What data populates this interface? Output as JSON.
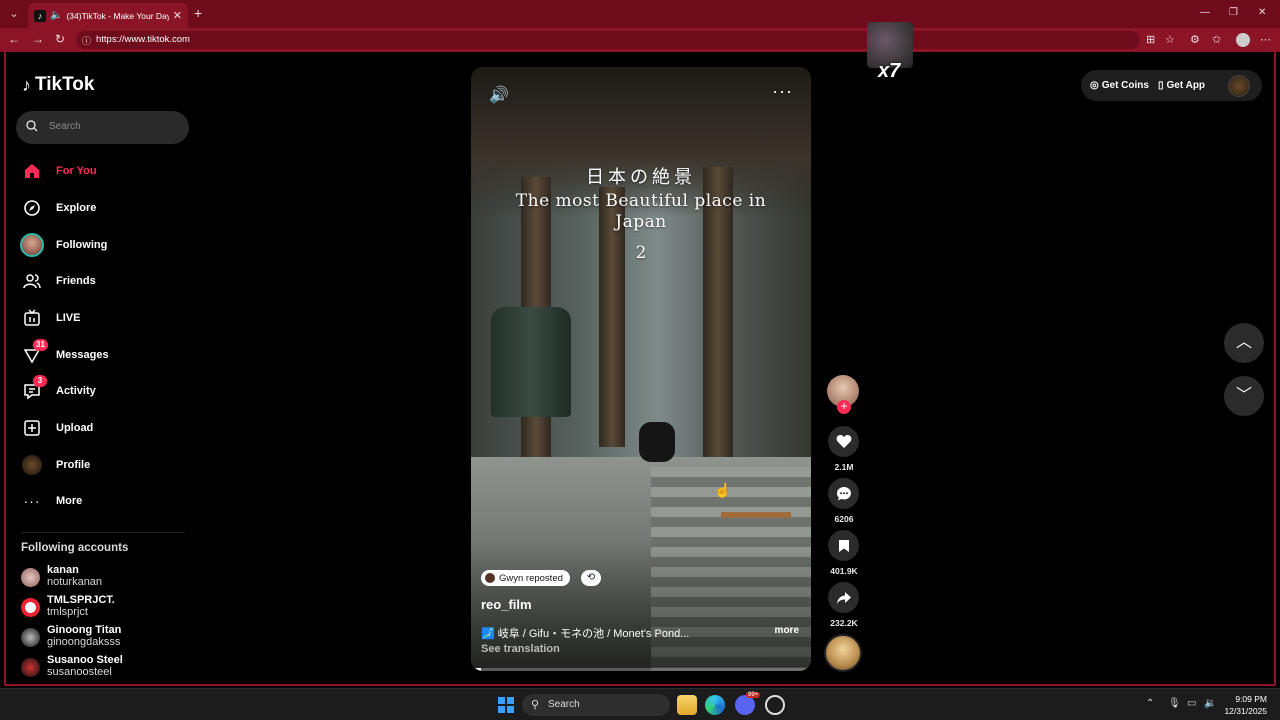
{
  "browser": {
    "tab_title": "(34)TikTok - Make Your Day",
    "url": "https://www.tiktok.com",
    "accent_color": "#8b1427"
  },
  "app": {
    "name": "TikTok"
  },
  "search": {
    "placeholder": "Search"
  },
  "nav": [
    {
      "label": "For You",
      "icon": "home-icon",
      "active": true
    },
    {
      "label": "Explore",
      "icon": "compass-icon"
    },
    {
      "label": "Following",
      "icon": "following-avatar-icon"
    },
    {
      "label": "Friends",
      "icon": "friends-icon"
    },
    {
      "label": "LIVE",
      "icon": "live-icon"
    },
    {
      "label": "Messages",
      "icon": "messages-icon",
      "badge": "31"
    },
    {
      "label": "Activity",
      "icon": "activity-icon",
      "badge": "3"
    },
    {
      "label": "Upload",
      "icon": "upload-icon"
    },
    {
      "label": "Profile",
      "icon": "profile-avatar-icon"
    },
    {
      "label": "More",
      "icon": "more-dots-icon"
    }
  ],
  "following_accounts": {
    "header": "Following accounts",
    "items": [
      {
        "name": "kanan",
        "handle": "noturkanan"
      },
      {
        "name": "TMLSPRJCT.",
        "handle": "tmlsprjct"
      },
      {
        "name": "Ginoong Titan",
        "handle": "ginoongdaksss"
      },
      {
        "name": "Susanoo Steel",
        "handle": "susanoosteel"
      }
    ]
  },
  "video": {
    "overlay_jp": "日本の絶景",
    "overlay_en": "The most Beautiful place in Japan",
    "overlay_num": "2",
    "repost_text": "Gwyn reposted",
    "author": "reo_film",
    "caption": "🗾 岐阜 / Gifu・モネの池 / Monet's Pond...",
    "caption_more": "more",
    "see_translation": "See translation",
    "progress": 0.03
  },
  "actions": {
    "likes": "2.1M",
    "comments": "6206",
    "saves": "401.9K",
    "shares": "232.2K"
  },
  "top_right": {
    "get_coins": "Get Coins",
    "get_app": "Get App"
  },
  "floating": {
    "label": "x7"
  },
  "taskbar": {
    "search": "Search",
    "time": "9:09 PM",
    "date": "12/31/2025",
    "chat_badge": "99+"
  }
}
